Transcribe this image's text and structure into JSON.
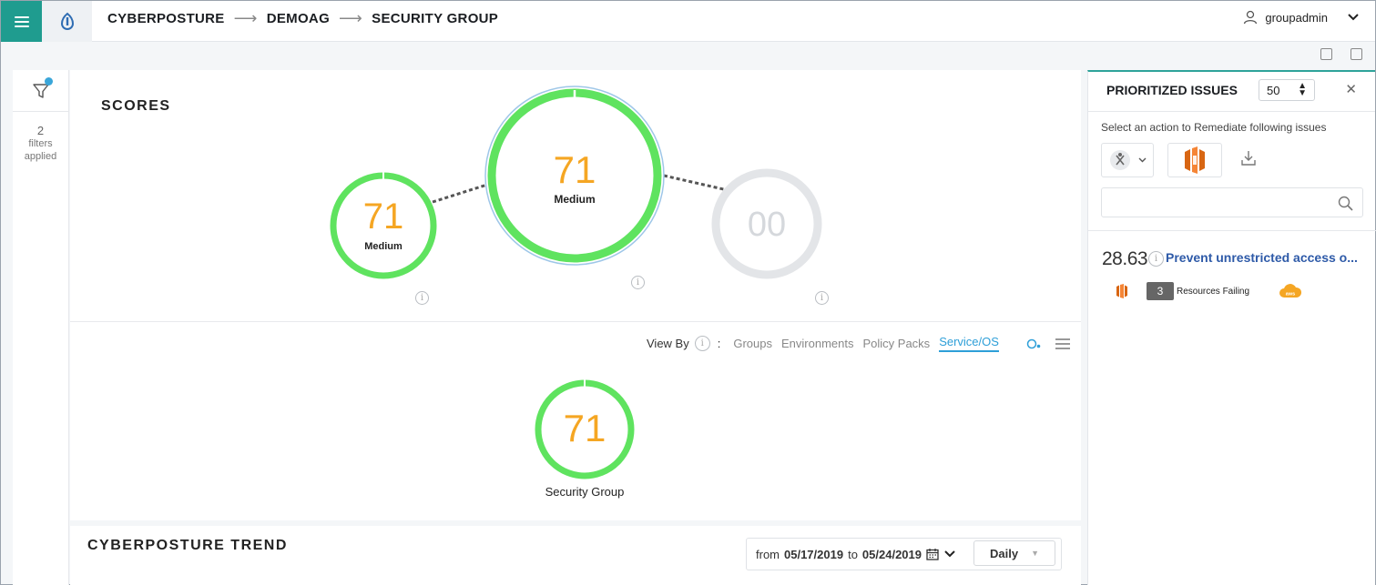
{
  "header": {
    "breadcrumb": [
      "CYBERPOSTURE",
      "DEMOAG",
      "SECURITY GROUP"
    ],
    "user": "groupadmin",
    "icons": [
      "menu-icon",
      "logo-icon",
      "user-icon",
      "chevron-down-icon"
    ]
  },
  "filters": {
    "count": "2",
    "line1": "filters",
    "line2": "applied"
  },
  "scores": {
    "title": "SCORES",
    "left": {
      "value": "71",
      "label": "Medium"
    },
    "center": {
      "value": "71",
      "label": "Medium"
    },
    "right": {
      "value": "00",
      "label": ""
    }
  },
  "viewby": {
    "label": "View By",
    "separator": ":",
    "options": [
      "Groups",
      "Environments",
      "Policy Packs",
      "Service/OS"
    ],
    "active": "Service/OS"
  },
  "service": {
    "value": "71",
    "label": "Security Group"
  },
  "trend": {
    "title": "CYBERPOSTURE TREND",
    "from_label": "from",
    "from_date": "05/17/2019",
    "to_label": "to",
    "to_date": "05/24/2019",
    "granularity": "Daily"
  },
  "issues": {
    "title": "PRIORITIZED ISSUES",
    "page_size": "50",
    "subtitle": "Select an action to Remediate following issues",
    "search_placeholder": "",
    "items": [
      {
        "score": "28.63",
        "title": "Prevent unrestricted access o...",
        "resources_count": "3",
        "resources_label": "Resources Failing",
        "cloud": "aws"
      }
    ]
  },
  "colors": {
    "accent": "#1f9c8f",
    "score_ring": "#5fe35f",
    "score_text": "#f5a623",
    "link": "#2e5aa8",
    "active_tab": "#2e9fd8"
  }
}
